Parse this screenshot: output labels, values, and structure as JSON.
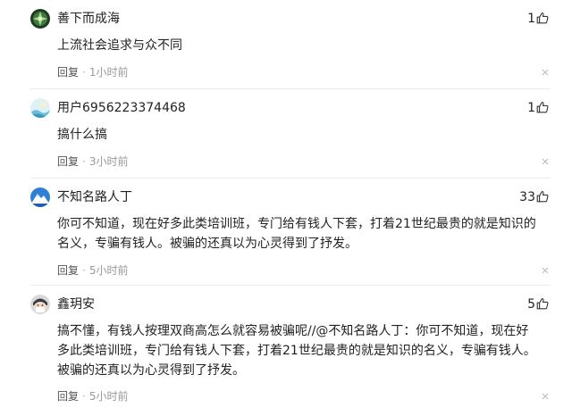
{
  "comments": [
    {
      "username": "善下而成海",
      "likes": "1",
      "text": "上流社会追求与众不同",
      "reply_label": "回复",
      "separator": "·",
      "time": "1小时前",
      "avatar": "leaf-pattern-avatar"
    },
    {
      "username": "用户6956223374468",
      "likes": "1",
      "text": "搞什么搞",
      "reply_label": "回复",
      "separator": "·",
      "time": "3小时前",
      "avatar": "light-blue-landscape-avatar"
    },
    {
      "username": "不知名路人丁",
      "likes": "33",
      "text": "你可不知道，现在好多此类培训班，专门给有钱人下套，打着21世纪最贵的就是知识的名义，专骗有钱人。被骗的还真以为心灵得到了抒发。",
      "reply_label": "回复",
      "separator": "·",
      "time": "5小时前",
      "avatar": "blue-mountain-avatar"
    },
    {
      "username": "鑫玥安",
      "likes": "5",
      "text": "搞不懂，有钱人按理双商高怎么就容易被骗呢//@不知名路人丁：你可不知道，现在好多此类培训班，专门给有钱人下套，打着21世纪最贵的就是知识的名义，专骗有钱人。被骗的还真以为心灵得到了抒发。",
      "reply_label": "回复",
      "separator": "·",
      "time": "5小时前",
      "avatar": "masked-person-avatar"
    }
  ],
  "icons": {
    "like": "thumbs-up-icon",
    "close": "close-icon"
  },
  "colors": {
    "text": "#222222",
    "meta": "#777777",
    "divider": "#ececec",
    "icon": "#999999"
  }
}
